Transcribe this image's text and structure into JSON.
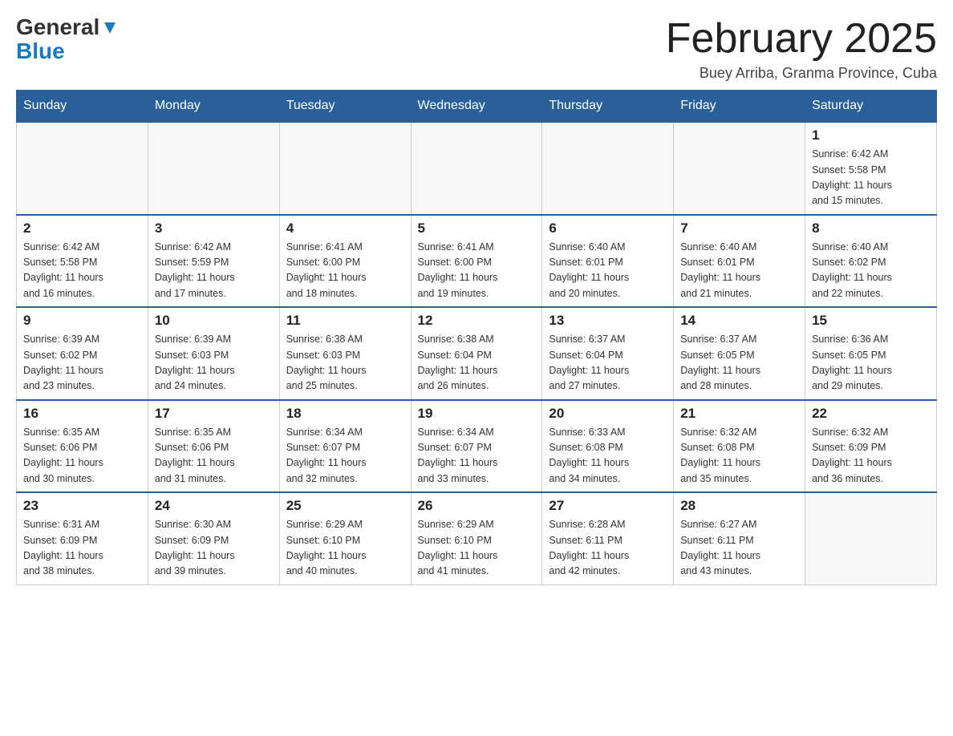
{
  "header": {
    "logo_general": "General",
    "logo_blue": "Blue",
    "month_title": "February 2025",
    "subtitle": "Buey Arriba, Granma Province, Cuba"
  },
  "weekdays": [
    "Sunday",
    "Monday",
    "Tuesday",
    "Wednesday",
    "Thursday",
    "Friday",
    "Saturday"
  ],
  "weeks": [
    [
      {
        "day": "",
        "info": ""
      },
      {
        "day": "",
        "info": ""
      },
      {
        "day": "",
        "info": ""
      },
      {
        "day": "",
        "info": ""
      },
      {
        "day": "",
        "info": ""
      },
      {
        "day": "",
        "info": ""
      },
      {
        "day": "1",
        "info": "Sunrise: 6:42 AM\nSunset: 5:58 PM\nDaylight: 11 hours\nand 15 minutes."
      }
    ],
    [
      {
        "day": "2",
        "info": "Sunrise: 6:42 AM\nSunset: 5:58 PM\nDaylight: 11 hours\nand 16 minutes."
      },
      {
        "day": "3",
        "info": "Sunrise: 6:42 AM\nSunset: 5:59 PM\nDaylight: 11 hours\nand 17 minutes."
      },
      {
        "day": "4",
        "info": "Sunrise: 6:41 AM\nSunset: 6:00 PM\nDaylight: 11 hours\nand 18 minutes."
      },
      {
        "day": "5",
        "info": "Sunrise: 6:41 AM\nSunset: 6:00 PM\nDaylight: 11 hours\nand 19 minutes."
      },
      {
        "day": "6",
        "info": "Sunrise: 6:40 AM\nSunset: 6:01 PM\nDaylight: 11 hours\nand 20 minutes."
      },
      {
        "day": "7",
        "info": "Sunrise: 6:40 AM\nSunset: 6:01 PM\nDaylight: 11 hours\nand 21 minutes."
      },
      {
        "day": "8",
        "info": "Sunrise: 6:40 AM\nSunset: 6:02 PM\nDaylight: 11 hours\nand 22 minutes."
      }
    ],
    [
      {
        "day": "9",
        "info": "Sunrise: 6:39 AM\nSunset: 6:02 PM\nDaylight: 11 hours\nand 23 minutes."
      },
      {
        "day": "10",
        "info": "Sunrise: 6:39 AM\nSunset: 6:03 PM\nDaylight: 11 hours\nand 24 minutes."
      },
      {
        "day": "11",
        "info": "Sunrise: 6:38 AM\nSunset: 6:03 PM\nDaylight: 11 hours\nand 25 minutes."
      },
      {
        "day": "12",
        "info": "Sunrise: 6:38 AM\nSunset: 6:04 PM\nDaylight: 11 hours\nand 26 minutes."
      },
      {
        "day": "13",
        "info": "Sunrise: 6:37 AM\nSunset: 6:04 PM\nDaylight: 11 hours\nand 27 minutes."
      },
      {
        "day": "14",
        "info": "Sunrise: 6:37 AM\nSunset: 6:05 PM\nDaylight: 11 hours\nand 28 minutes."
      },
      {
        "day": "15",
        "info": "Sunrise: 6:36 AM\nSunset: 6:05 PM\nDaylight: 11 hours\nand 29 minutes."
      }
    ],
    [
      {
        "day": "16",
        "info": "Sunrise: 6:35 AM\nSunset: 6:06 PM\nDaylight: 11 hours\nand 30 minutes."
      },
      {
        "day": "17",
        "info": "Sunrise: 6:35 AM\nSunset: 6:06 PM\nDaylight: 11 hours\nand 31 minutes."
      },
      {
        "day": "18",
        "info": "Sunrise: 6:34 AM\nSunset: 6:07 PM\nDaylight: 11 hours\nand 32 minutes."
      },
      {
        "day": "19",
        "info": "Sunrise: 6:34 AM\nSunset: 6:07 PM\nDaylight: 11 hours\nand 33 minutes."
      },
      {
        "day": "20",
        "info": "Sunrise: 6:33 AM\nSunset: 6:08 PM\nDaylight: 11 hours\nand 34 minutes."
      },
      {
        "day": "21",
        "info": "Sunrise: 6:32 AM\nSunset: 6:08 PM\nDaylight: 11 hours\nand 35 minutes."
      },
      {
        "day": "22",
        "info": "Sunrise: 6:32 AM\nSunset: 6:09 PM\nDaylight: 11 hours\nand 36 minutes."
      }
    ],
    [
      {
        "day": "23",
        "info": "Sunrise: 6:31 AM\nSunset: 6:09 PM\nDaylight: 11 hours\nand 38 minutes."
      },
      {
        "day": "24",
        "info": "Sunrise: 6:30 AM\nSunset: 6:09 PM\nDaylight: 11 hours\nand 39 minutes."
      },
      {
        "day": "25",
        "info": "Sunrise: 6:29 AM\nSunset: 6:10 PM\nDaylight: 11 hours\nand 40 minutes."
      },
      {
        "day": "26",
        "info": "Sunrise: 6:29 AM\nSunset: 6:10 PM\nDaylight: 11 hours\nand 41 minutes."
      },
      {
        "day": "27",
        "info": "Sunrise: 6:28 AM\nSunset: 6:11 PM\nDaylight: 11 hours\nand 42 minutes."
      },
      {
        "day": "28",
        "info": "Sunrise: 6:27 AM\nSunset: 6:11 PM\nDaylight: 11 hours\nand 43 minutes."
      },
      {
        "day": "",
        "info": ""
      }
    ]
  ]
}
